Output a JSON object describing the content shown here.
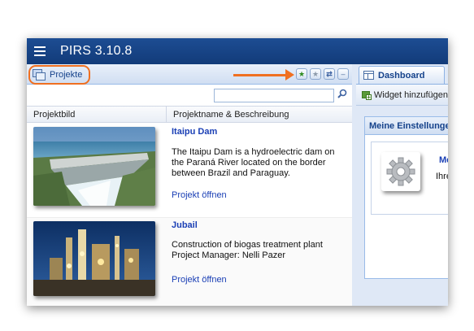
{
  "app": {
    "title": "PIRS 3.10.8"
  },
  "projects_panel": {
    "tab_label": "Projekte",
    "search": {
      "value": "",
      "placeholder": ""
    },
    "columns": [
      "Projektbild",
      "Projektname & Beschreibung"
    ],
    "rows": [
      {
        "name": "Itaipu Dam",
        "description": "The Itaipu Dam is a hydroelectric dam on the Paraná River located on the border between Brazil and Paraguay.",
        "link": "Projekt öffnen",
        "image": "hydroelectric-dam-photo"
      },
      {
        "name": "Jubail",
        "description": "Construction of biogas treatment plant Project Manager: Nelli Pazer",
        "link": "Projekt öffnen",
        "image": "industrial-plant-night-photo"
      }
    ]
  },
  "dashboard": {
    "tab_label": "Dashboard",
    "toolbar_label": "Widget hinzufügen",
    "settings_title": "Meine Einstellungen",
    "settings_link": "Me",
    "settings_text": "Ihre"
  },
  "icons": {
    "menu": "hamburger-icon",
    "projects": "windows-icon",
    "favorite_add": "star-add-icon",
    "favorite": "star-icon",
    "refresh": "refresh-icon",
    "minimize": "minimize-icon",
    "search": "search-icon",
    "dashboard": "dashboard-icon",
    "widget_add": "widget-add-icon",
    "settings": "gear-icon"
  },
  "colors": {
    "titlebar": "#1d4d93",
    "highlight": "#f07021",
    "link": "#1a3fb5",
    "panel_bg": "#dfe8f6"
  }
}
